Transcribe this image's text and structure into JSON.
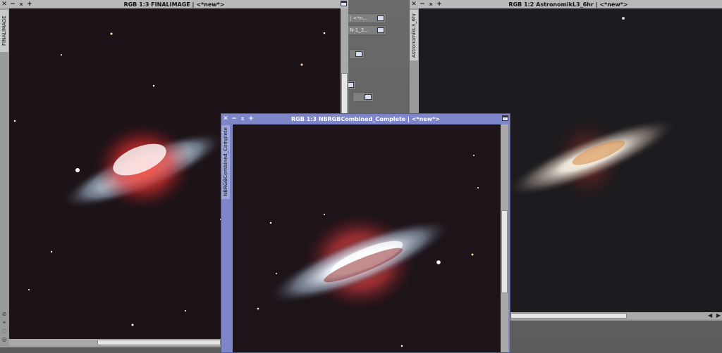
{
  "windows": {
    "w1": {
      "title": "RGB 1:3 FINALIMAGE | <*new*>",
      "side_label": "FINALIMAGE",
      "buttons": {
        "close": "✕",
        "minimize": "−",
        "shade": "⌅",
        "maximize": "+"
      }
    },
    "w2": {
      "title": "RGB 1:2 AstronomikL3_6hr | <*new*>",
      "side_label": "AstronomikL3_6hr",
      "buttons": {
        "close": "✕",
        "minimize": "−",
        "shade": "⌅",
        "maximize": "+"
      }
    },
    "w3": {
      "title": "RGB 1:3 NBRGBCombined_Complete | <*new*>",
      "side_label": "NBRGBCombined_Complete",
      "buttons": {
        "close": "✕",
        "minimize": "−",
        "shade": "⌅",
        "maximize": "+"
      }
    }
  },
  "iconized": [
    {
      "label": "| <*n..."
    },
    {
      "label": "N-1_3..."
    },
    {
      "label": ""
    },
    {
      "label": ""
    },
    {
      "label": ""
    }
  ],
  "left_controls": [
    "⊘",
    "⌖",
    "◌",
    "◎"
  ],
  "hscroll_arrows": {
    "left": "◀",
    "right": "▶"
  },
  "colors": {
    "active_titlebar": "#7d86c8",
    "inactive_titlebar": "#b9b9b9",
    "workspace": "#6a6a6a"
  }
}
